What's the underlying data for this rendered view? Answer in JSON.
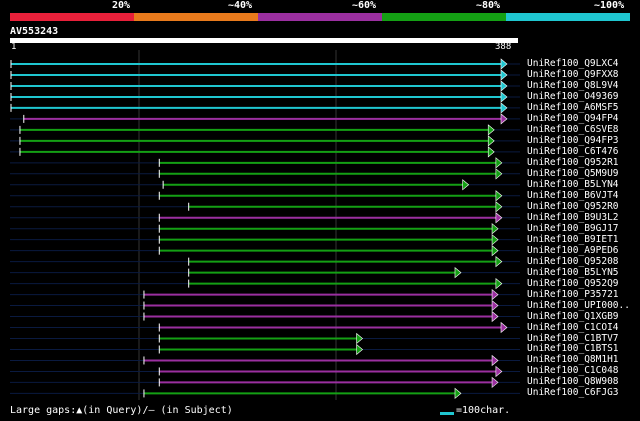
{
  "legend": {
    "items": [
      {
        "label": "20%",
        "color": "#e8203a"
      },
      {
        "label": "~40%",
        "color": "#e87a1c"
      },
      {
        "label": "~60%",
        "color": "#9b2fa0"
      },
      {
        "label": "~80%",
        "color": "#14a014"
      },
      {
        "label": "~100%",
        "color": "#1fc6d0"
      }
    ]
  },
  "query": {
    "name": "AV553243",
    "start": "1",
    "end": "388"
  },
  "hits": [
    {
      "name": "UniRef100_Q9LXC4",
      "color": "#1fc6d0",
      "start": 0,
      "end": 388
    },
    {
      "name": "UniRef100_Q9FXX8",
      "color": "#1fc6d0",
      "start": 0,
      "end": 388
    },
    {
      "name": "UniRef100_Q8L9V4",
      "color": "#1fc6d0",
      "start": 0,
      "end": 388
    },
    {
      "name": "UniRef100_O49369",
      "color": "#1fc6d0",
      "start": 0,
      "end": 388
    },
    {
      "name": "UniRef100_A6MSF5",
      "color": "#1fc6d0",
      "start": 0,
      "end": 388
    },
    {
      "name": "UniRef100_Q94FP4",
      "color": "#9b2fa0",
      "start": 10,
      "end": 388
    },
    {
      "name": "UniRef100_C6SVE8",
      "color": "#14a014",
      "start": 7,
      "end": 378
    },
    {
      "name": "UniRef100_Q94FP3",
      "color": "#14a014",
      "start": 7,
      "end": 378
    },
    {
      "name": "UniRef100_C6T476",
      "color": "#14a014",
      "start": 7,
      "end": 378
    },
    {
      "name": "UniRef100_Q952R1",
      "color": "#14a014",
      "start": 116,
      "end": 384
    },
    {
      "name": "UniRef100_Q5M9U9",
      "color": "#14a014",
      "start": 116,
      "end": 384
    },
    {
      "name": "UniRef100_B5LYN4",
      "color": "#14a014",
      "start": 119,
      "end": 358
    },
    {
      "name": "UniRef100_B6VJT4",
      "color": "#14a014",
      "start": 116,
      "end": 384
    },
    {
      "name": "UniRef100_Q952R0",
      "color": "#14a014",
      "start": 139,
      "end": 384
    },
    {
      "name": "UniRef100_B9U3L2",
      "color": "#9b2fa0",
      "start": 116,
      "end": 384
    },
    {
      "name": "UniRef100_B9GJ17",
      "color": "#14a014",
      "start": 116,
      "end": 381
    },
    {
      "name": "UniRef100_B9IET1",
      "color": "#14a014",
      "start": 116,
      "end": 381
    },
    {
      "name": "UniRef100_A9PED6",
      "color": "#14a014",
      "start": 116,
      "end": 381
    },
    {
      "name": "UniRef100_Q95208",
      "color": "#14a014",
      "start": 139,
      "end": 384
    },
    {
      "name": "UniRef100_B5LYN5",
      "color": "#14a014",
      "start": 139,
      "end": 352
    },
    {
      "name": "UniRef100_Q952Q9",
      "color": "#14a014",
      "start": 139,
      "end": 384
    },
    {
      "name": "UniRef100_P35721",
      "color": "#9b2fa0",
      "start": 104,
      "end": 381
    },
    {
      "name": "UniRef100_UPI000..",
      "color": "#9b2fa0",
      "start": 104,
      "end": 381
    },
    {
      "name": "UniRef100_Q1XGB9",
      "color": "#9b2fa0",
      "start": 104,
      "end": 381
    },
    {
      "name": "UniRef100_C1COI4",
      "color": "#9b2fa0",
      "start": 116,
      "end": 388
    },
    {
      "name": "UniRef100_C1BTV7",
      "color": "#14a014",
      "start": 116,
      "end": 275
    },
    {
      "name": "UniRef100_C1BTS1",
      "color": "#14a014",
      "start": 116,
      "end": 275
    },
    {
      "name": "UniRef100_Q8M1H1",
      "color": "#9b2fa0",
      "start": 104,
      "end": 381
    },
    {
      "name": "UniRef100_C1C048",
      "color": "#9b2fa0",
      "start": 116,
      "end": 384
    },
    {
      "name": "UniRef100_Q8W908",
      "color": "#9b2fa0",
      "start": 116,
      "end": 381
    },
    {
      "name": "UniRef100_C6FJG3",
      "color": "#14a014",
      "start": 104,
      "end": 352
    }
  ],
  "footer": {
    "gaps_text": "Large gaps:▲(in Query)/— (in Subject)",
    "scale_text": "=100char."
  }
}
